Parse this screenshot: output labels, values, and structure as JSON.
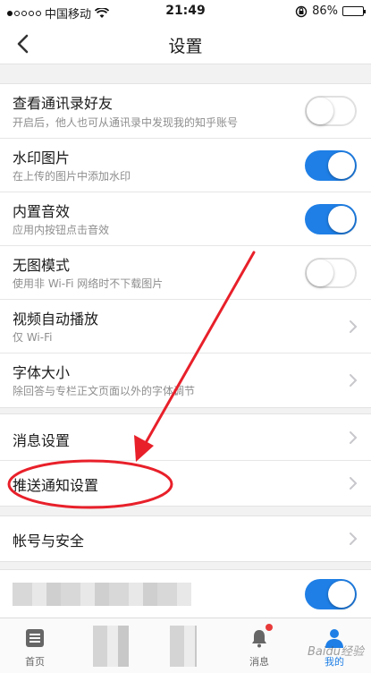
{
  "status": {
    "carrier": "中国移动",
    "time": "21:49",
    "battery": "86%",
    "battery_level": 0.86
  },
  "nav": {
    "title": "设置"
  },
  "section1": [
    {
      "title": "查看通讯录好友",
      "subtitle": "开启后，他人也可从通讯录中发现我的知乎账号",
      "control": "toggle",
      "on": false
    },
    {
      "title": "水印图片",
      "subtitle": "在上传的图片中添加水印",
      "control": "toggle",
      "on": true
    },
    {
      "title": "内置音效",
      "subtitle": "应用内按钮点击音效",
      "control": "toggle",
      "on": true
    },
    {
      "title": "无图模式",
      "subtitle": "使用非 Wi-Fi 网络时不下载图片",
      "control": "toggle",
      "on": false
    },
    {
      "title": "视频自动播放",
      "subtitle": "仅 Wi-Fi",
      "control": "chevron"
    },
    {
      "title": "字体大小",
      "subtitle": "除回答与专栏正文页面以外的字体调节",
      "control": "chevron"
    }
  ],
  "section2": [
    {
      "title": "消息设置",
      "control": "chevron"
    },
    {
      "title": "推送通知设置",
      "control": "chevron"
    }
  ],
  "section3": [
    {
      "title": "帐号与安全",
      "control": "chevron"
    }
  ],
  "section4": {
    "toggle_on": true
  },
  "tabs": [
    {
      "label": "首页",
      "icon": "home-icon",
      "active": false
    },
    {
      "label": "消息",
      "icon": "bell-icon",
      "active": false
    },
    {
      "label": "我的",
      "icon": "profile-icon",
      "active": true
    }
  ],
  "watermark": "Baidu经验",
  "colors": {
    "accent": "#1f7fe6",
    "annotation": "#e8202a"
  }
}
